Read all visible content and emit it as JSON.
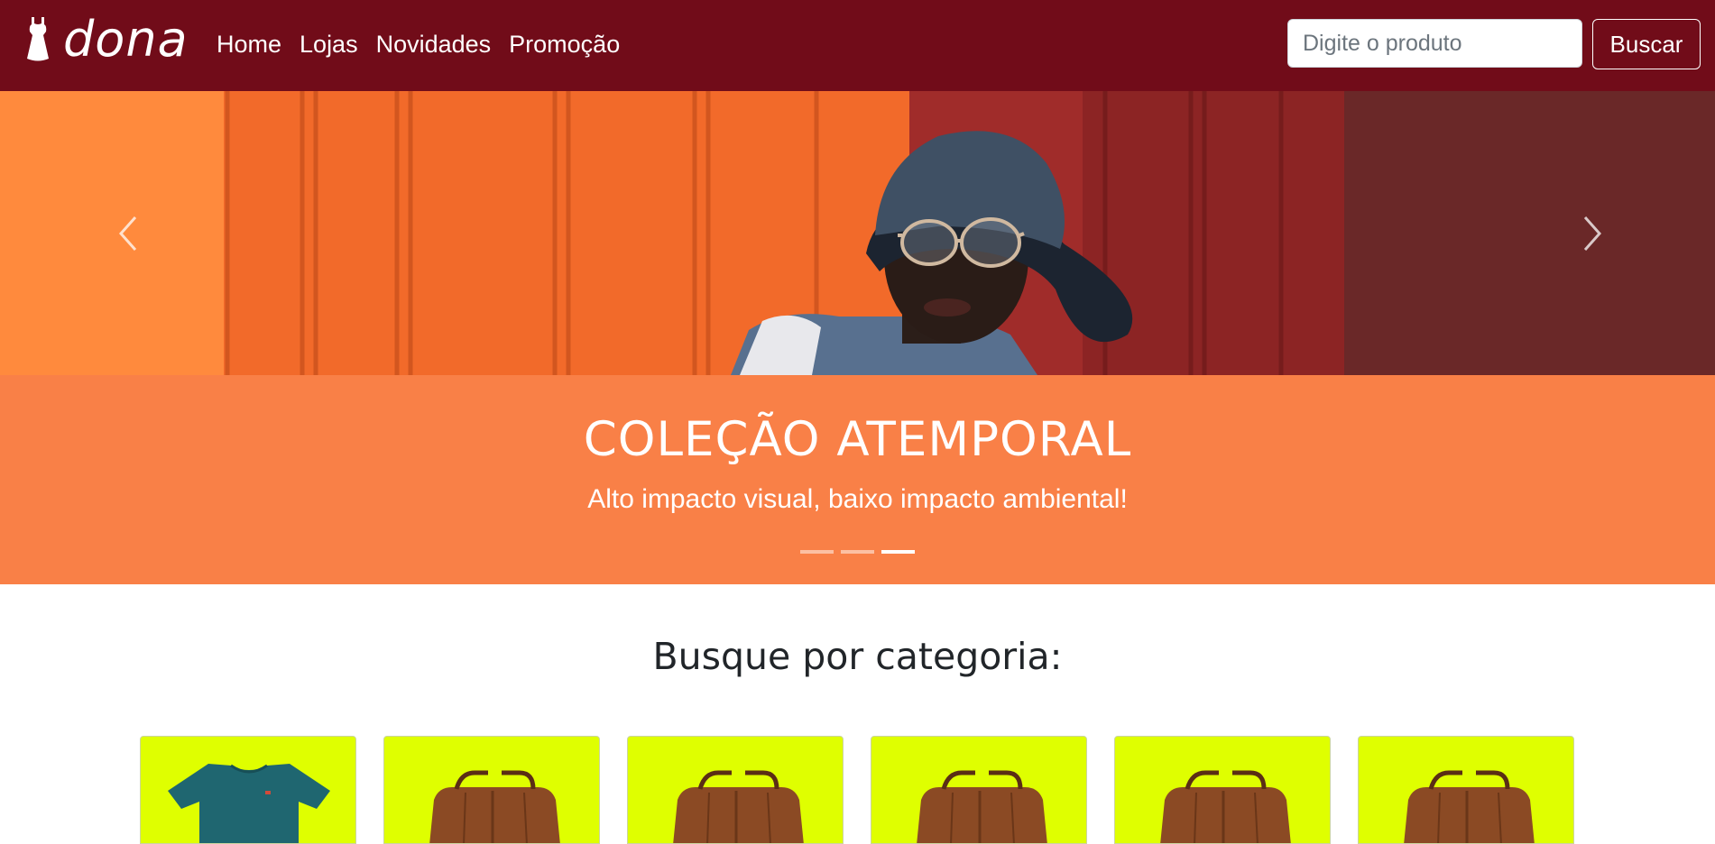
{
  "brand": {
    "name": "dona",
    "icon": "dress-icon"
  },
  "nav": {
    "links": [
      "Home",
      "Lojas",
      "Novidades",
      "Promoção"
    ]
  },
  "search": {
    "placeholder": "Digite o produto",
    "value": "",
    "button_label": "Buscar"
  },
  "carousel": {
    "title": "COLEÇÃO ATEMPORAL",
    "subtitle": "Alto impacto visual, baixo impacto ambiental!",
    "active_slide": 3,
    "slide_count": 3,
    "prev_icon": "chevron-left-icon",
    "next_icon": "chevron-right-icon"
  },
  "categories": {
    "title": "Busque por categoria:",
    "items": [
      {
        "image": "tshirt-image"
      },
      {
        "image": "bag-image"
      },
      {
        "image": "bag-image"
      },
      {
        "image": "bag-image"
      },
      {
        "image": "bag-image"
      },
      {
        "image": "bag-image"
      }
    ]
  },
  "colors": {
    "navbar": "#710c19",
    "caption": "#f98047",
    "category_card": "#dfff00"
  }
}
